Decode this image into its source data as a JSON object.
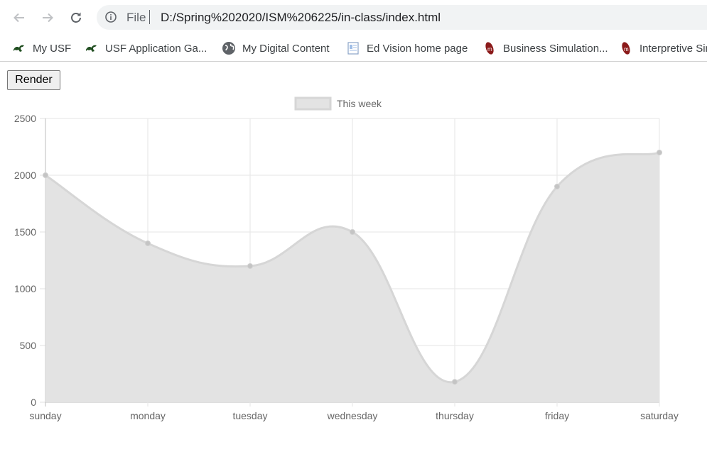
{
  "browser": {
    "address": {
      "file_label": "File",
      "url": "D:/Spring%202020/ISM%206225/in-class/index.html"
    },
    "bookmarks": [
      {
        "label": "My USF",
        "icon": "usf-bull-icon"
      },
      {
        "label": "USF Application Ga...",
        "icon": "usf-bull-icon"
      },
      {
        "label": "My Digital Content",
        "icon": "globe-icon"
      },
      {
        "label": "Ed Vision home page",
        "icon": "document-icon"
      },
      {
        "label": "Business Simulation...",
        "icon": "book-icon"
      },
      {
        "label": "Interpretive Sir",
        "icon": "book-icon"
      }
    ]
  },
  "page": {
    "render_button": "Render"
  },
  "chart_data": {
    "type": "area",
    "categories": [
      "sunday",
      "monday",
      "tuesday",
      "wednesday",
      "thursday",
      "friday",
      "saturday"
    ],
    "series": [
      {
        "name": "This week",
        "values": [
          2000,
          1400,
          1200,
          1500,
          180,
          1900,
          2200
        ]
      }
    ],
    "ylim": [
      0,
      2500
    ],
    "yticks": [
      "0",
      "500",
      "1000",
      "1500",
      "2000",
      "2500"
    ],
    "grid": true,
    "legend": "top-center",
    "fill_color": "#e3e3e3",
    "line_color": "#d6d6d6",
    "point_color": "#c4c4c4"
  }
}
